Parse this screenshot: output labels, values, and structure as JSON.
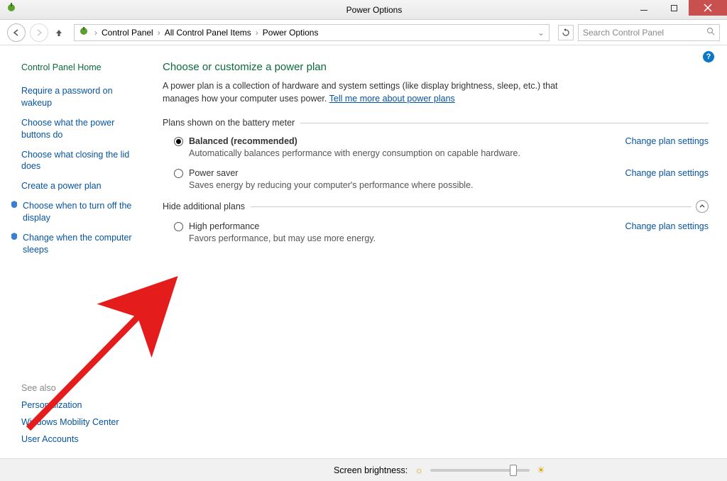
{
  "titlebar": {
    "title": "Power Options"
  },
  "breadcrumb": {
    "items": [
      "Control Panel",
      "All Control Panel Items",
      "Power Options"
    ]
  },
  "search": {
    "placeholder": "Search Control Panel"
  },
  "sidebar": {
    "home": "Control Panel Home",
    "links": [
      "Require a password on wakeup",
      "Choose what the power buttons do",
      "Choose what closing the lid does",
      "Create a power plan",
      "Choose when to turn off the display",
      "Change when the computer sleeps"
    ]
  },
  "seealso": {
    "title": "See also",
    "links": [
      "Personalization",
      "Windows Mobility Center",
      "User Accounts"
    ]
  },
  "main": {
    "heading": "Choose or customize a power plan",
    "desc_pre": "A power plan is a collection of hardware and system settings (like display brightness, sleep, etc.) that manages how your computer uses power. ",
    "desc_link": "Tell me more about power plans",
    "group_meter": "Plans shown on the battery meter",
    "group_hide": "Hide additional plans",
    "change_link": "Change plan settings",
    "plans_meter": [
      {
        "name": "Balanced (recommended)",
        "desc": "Automatically balances performance with energy consumption on capable hardware.",
        "selected": true
      },
      {
        "name": "Power saver",
        "desc": "Saves energy by reducing your computer's performance where possible.",
        "selected": false
      }
    ],
    "plans_extra": [
      {
        "name": "High performance",
        "desc": "Favors performance, but may use more energy.",
        "selected": false
      }
    ]
  },
  "brightness": {
    "label": "Screen brightness:"
  }
}
